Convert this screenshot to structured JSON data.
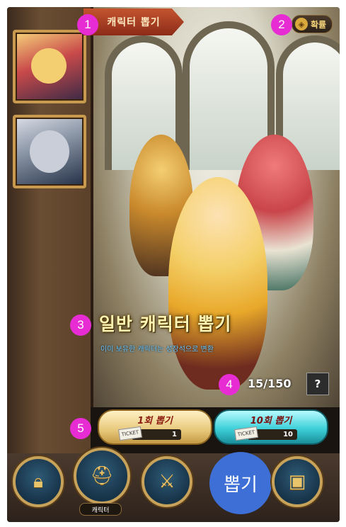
{
  "header": {
    "title_tab": "캐릭터 뽑기",
    "rate_button": "확률"
  },
  "banner": {
    "headline": "일반 캐릭터 뽑기",
    "subtext": "이미 보유한 캐릭터는 성장석으로 변환",
    "counter": "15/150",
    "help_label": "?"
  },
  "pull_buttons": {
    "single": {
      "label": "1회 뽑기",
      "ticket": "TICKET",
      "cost": "1"
    },
    "ten": {
      "label": "10회 뽑기",
      "ticket": "TICKET",
      "cost": "10"
    }
  },
  "bottom_nav": {
    "character_label": "캐릭터",
    "pull_label": "뽑기"
  },
  "markers": [
    "1",
    "2",
    "3",
    "4",
    "5"
  ],
  "colors": {
    "marker": "#e82cd4",
    "pull_button": "#3d6fd6",
    "title_tab": "#a63a20"
  }
}
